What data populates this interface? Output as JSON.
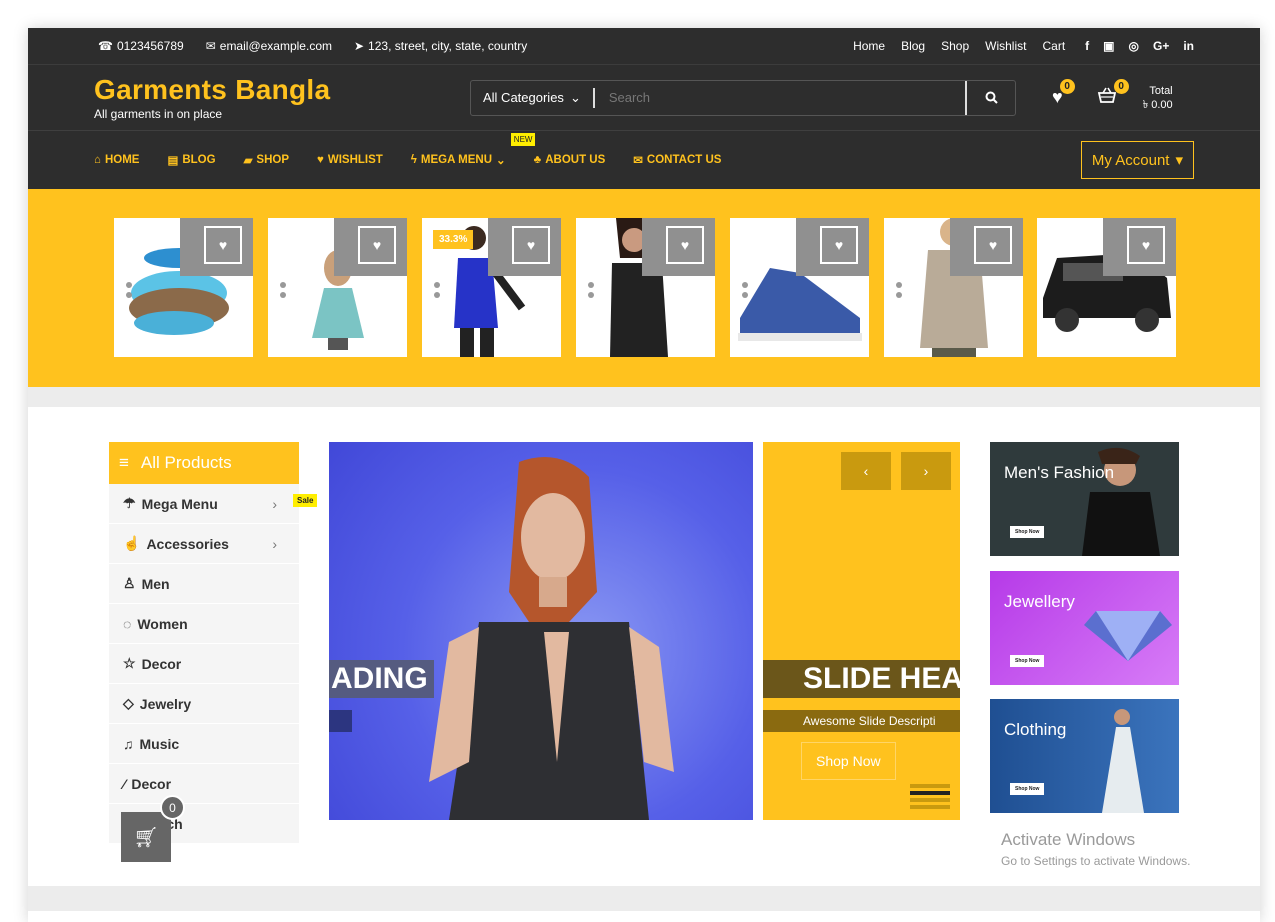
{
  "topbar": {
    "phone": "0123456789",
    "email": "email@example.com",
    "address": "123, street, city, state, country",
    "links": [
      "Home",
      "Blog",
      "Shop",
      "Wishlist",
      "Cart"
    ],
    "social": [
      "f",
      "▣",
      "◎",
      "G+",
      "in"
    ]
  },
  "header": {
    "brand": "Garments Bangla",
    "tagline": "All garments in on place",
    "category": "All Categories",
    "search_placeholder": "Search",
    "wishlist_count": "0",
    "cart_count": "0",
    "total_label": "Total",
    "total_value": "৳ 0.00"
  },
  "nav": {
    "items": [
      "HOME",
      "BLOG",
      "SHOP",
      "WISHLIST",
      "MEGA MENU",
      "ABOUT US",
      "CONTACT US"
    ],
    "new_badge": "NEW",
    "account": "My Account"
  },
  "products": {
    "discount": "33.3%"
  },
  "sidebar": {
    "title": "All Products",
    "sale_badge": "Sale",
    "items": [
      "Mega Menu",
      "Accessories",
      "Men",
      "Women",
      "Decor",
      "Jewelry",
      "Music",
      "Decor",
      "Watch"
    ]
  },
  "slider": {
    "heading1": "ADING",
    "heading2": "SLIDE HEA",
    "description": "Awesome Slide Descripti",
    "button": "Shop Now"
  },
  "promos": [
    {
      "title": "Men's Fashion",
      "button": "Shop Now",
      "color": "#2f3a3c"
    },
    {
      "title": "Jewellery",
      "button": "Shop Now",
      "color": "#c04cf0"
    },
    {
      "title": "Clothing",
      "button": "Shop Now",
      "color": "#2b5c9c"
    }
  ],
  "floating_cart": {
    "count": "0"
  },
  "watermark": {
    "line1": "Activate Windows",
    "line2": "Go to Settings to activate Windows."
  },
  "colors": {
    "accent": "#ffc21e",
    "dark": "#2d2d2d"
  }
}
